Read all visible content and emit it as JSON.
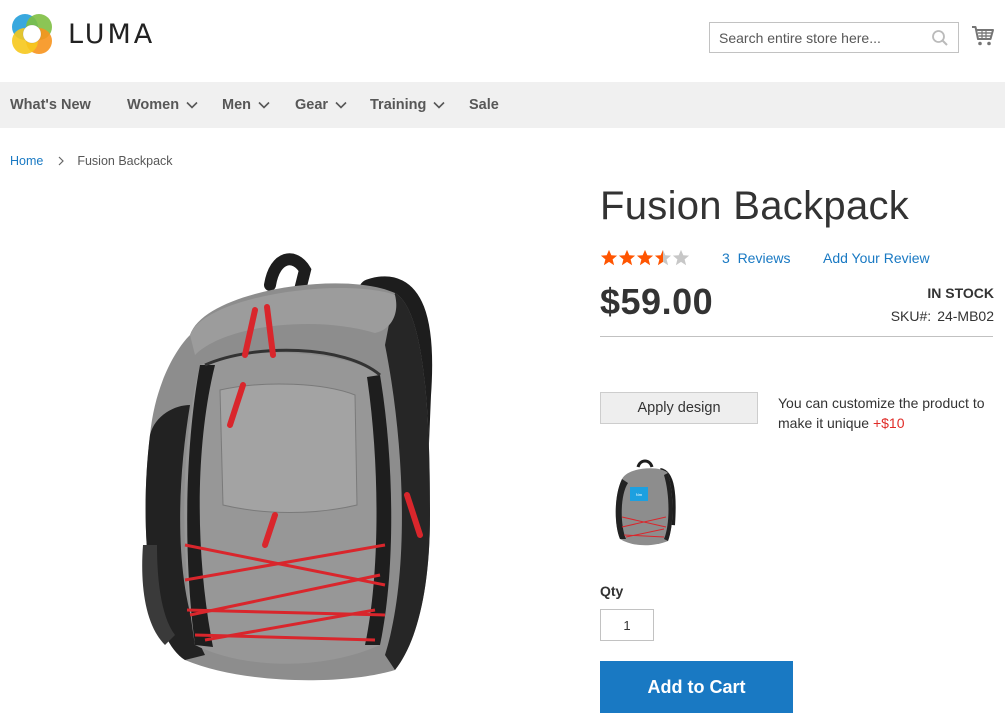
{
  "header": {
    "logo_text": "LUMA",
    "search_placeholder": "Search entire store here...",
    "cart_icon": "cart-icon",
    "search_icon": "search-icon"
  },
  "nav": {
    "items": [
      {
        "label": "What's New",
        "has_dropdown": false
      },
      {
        "label": "Women",
        "has_dropdown": true
      },
      {
        "label": "Men",
        "has_dropdown": true
      },
      {
        "label": "Gear",
        "has_dropdown": true
      },
      {
        "label": "Training",
        "has_dropdown": true
      },
      {
        "label": "Sale",
        "has_dropdown": false
      }
    ]
  },
  "breadcrumb": {
    "home": "Home",
    "current": "Fusion Backpack"
  },
  "product": {
    "title": "Fusion Backpack",
    "rating_stars": 3.5,
    "rating_max": 5,
    "reviews_label": "3  Reviews",
    "add_review_label": "Add Your Review",
    "price": "$59.00",
    "stock": "IN STOCK",
    "sku_label": "SKU#:",
    "sku_value": "24-MB02",
    "apply_design_label": "Apply design",
    "customize_note": "You can customize the product to make it unique",
    "customize_price": "+$10",
    "qty_label": "Qty",
    "qty_value": "1",
    "add_to_cart_label": "Add to Cart"
  },
  "colors": {
    "accent_blue": "#1979c3",
    "star_orange": "#ff5501",
    "price_red": "#e02b27",
    "nav_bg": "#f0f0f0"
  }
}
